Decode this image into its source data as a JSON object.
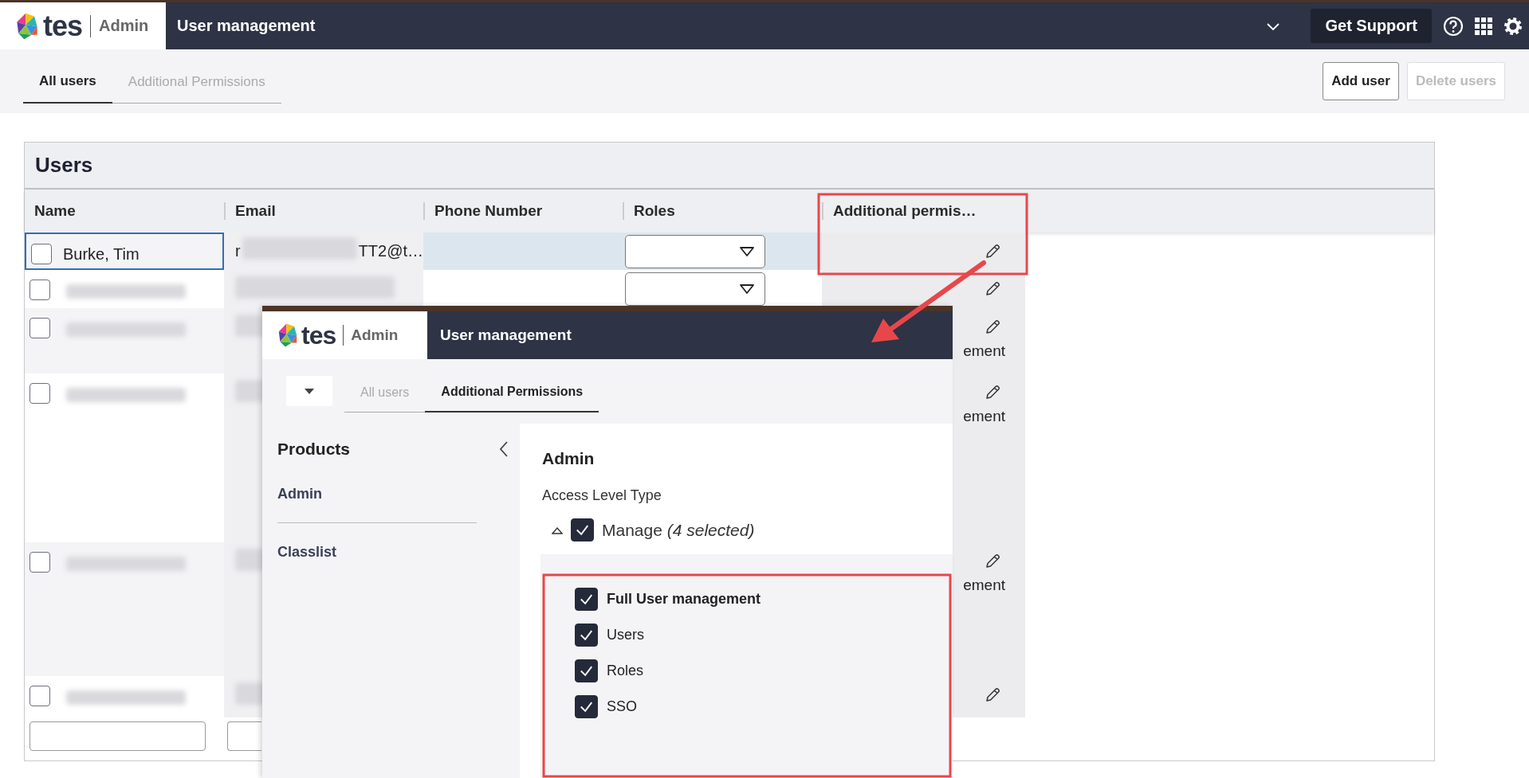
{
  "header": {
    "logo_text": "tes",
    "product": "Admin",
    "title": "User management",
    "support_button": "Get Support"
  },
  "tabs": [
    {
      "label": "All users",
      "selected": true
    },
    {
      "label": "Additional Permissions",
      "selected": false
    }
  ],
  "actions": [
    {
      "label": "Add user",
      "disabled": false
    },
    {
      "label": "Delete users",
      "disabled": true
    }
  ],
  "users_panel": {
    "title": "Users",
    "columns": [
      "Name",
      "Email",
      "Phone Number",
      "Roles",
      "Additional permis…"
    ],
    "rows": [
      {
        "kind": "named",
        "name": "Burke, Tim",
        "email_start": "r",
        "email_end": "TT2@t…",
        "checked": false,
        "focused": true,
        "roles_dropdown": true
      },
      {
        "kind": "redacted",
        "checked": false,
        "focused": false,
        "roles_dropdown": true
      },
      {
        "kind": "redacted",
        "checked": false,
        "focused": false,
        "roles_dropdown": false,
        "permissions": "ement"
      },
      {
        "kind": "redacted",
        "checked": false,
        "focused": false,
        "roles_dropdown": false,
        "permissions": "ement"
      },
      {
        "kind": "redacted",
        "checked": false,
        "focused": false,
        "roles_dropdown": false,
        "permissions": "ement"
      },
      {
        "kind": "redacted",
        "checked": false,
        "focused": false,
        "roles_dropdown": false
      }
    ]
  },
  "inset": {
    "header": {
      "logo_text": "tes",
      "product": "Admin",
      "title": "User management"
    },
    "tabs": [
      {
        "label": "All users",
        "selected": false
      },
      {
        "label": "Additional Permissions",
        "selected": true
      }
    ],
    "products_title": "Products",
    "products": [
      {
        "label": "Admin"
      },
      {
        "label": "Classlist"
      }
    ],
    "detail": {
      "title": "Admin",
      "access_label": "Access Level Type",
      "group": {
        "label": "Manage *(4 selected)*",
        "checked": true,
        "expanded": true
      },
      "options": [
        {
          "kind": "parent",
          "label": "Full User management",
          "checked": true
        },
        {
          "kind": "child",
          "label": "Users",
          "checked": true
        },
        {
          "kind": "child",
          "label": "Roles",
          "checked": true
        },
        {
          "kind": "child",
          "label": "SSO",
          "checked": true
        }
      ]
    }
  }
}
